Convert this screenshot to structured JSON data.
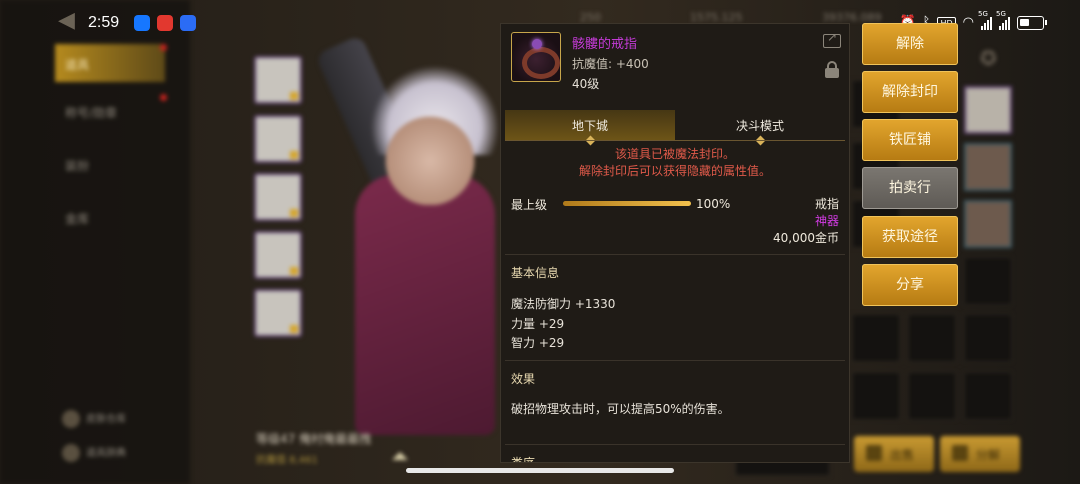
{
  "status_bar": {
    "time": "2:59",
    "hd_label": "HD",
    "sig1_label": "5G",
    "sig2_label": "5G"
  },
  "background": {
    "left_tabs": [
      "道具",
      "称号/勋章",
      "装扮",
      "金库"
    ],
    "left_bottom": [
      "皮肤仓库",
      "道具辞典"
    ],
    "top_currency": [
      "250",
      "1575.125",
      "39376.089"
    ],
    "character_level": "等级47 俺村俺最最拽",
    "character_resist": "抗魔值 8,461",
    "bottom_buttons": [
      "出售",
      "分解"
    ]
  },
  "item": {
    "name": "骸髏的戒指",
    "resist_label": "抗魔值: +400",
    "level_label": "40级",
    "icon": "ring-icon"
  },
  "tabs": [
    {
      "label": "地下城",
      "active": true
    },
    {
      "label": "决斗模式",
      "active": false
    }
  ],
  "seal_message": {
    "line1": "该道具已被魔法封印。",
    "line2": "解除封印后可以获得隐藏的属性值。"
  },
  "upgrade": {
    "label": "最上级",
    "percent_text": "100%",
    "progress": 1.0
  },
  "item_meta": {
    "type": "戒指",
    "rarity": "神器",
    "price": "40,000金币"
  },
  "basic_info": {
    "title": "基本信息",
    "stats": [
      "魔法防御力 +1330",
      "力量 +29",
      "智力 +29"
    ]
  },
  "effect": {
    "title": "效果",
    "text": "破招物理攻击时，可以提高50%的伤害。"
  },
  "cut_section_title": "类序",
  "actions": [
    {
      "label": "解除",
      "style": "gold"
    },
    {
      "label": "解除封印",
      "style": "gold"
    },
    {
      "label": "铁匠铺",
      "style": "gold"
    },
    {
      "label": "拍卖行",
      "style": "grey"
    },
    {
      "label": "获取途径",
      "style": "gold"
    },
    {
      "label": "分享",
      "style": "gold"
    }
  ],
  "colors": {
    "item_name": "#c33bd6",
    "seal_warning": "#e05a4a",
    "rarity": "#d23be3",
    "button_gold": "#e3a62e"
  }
}
